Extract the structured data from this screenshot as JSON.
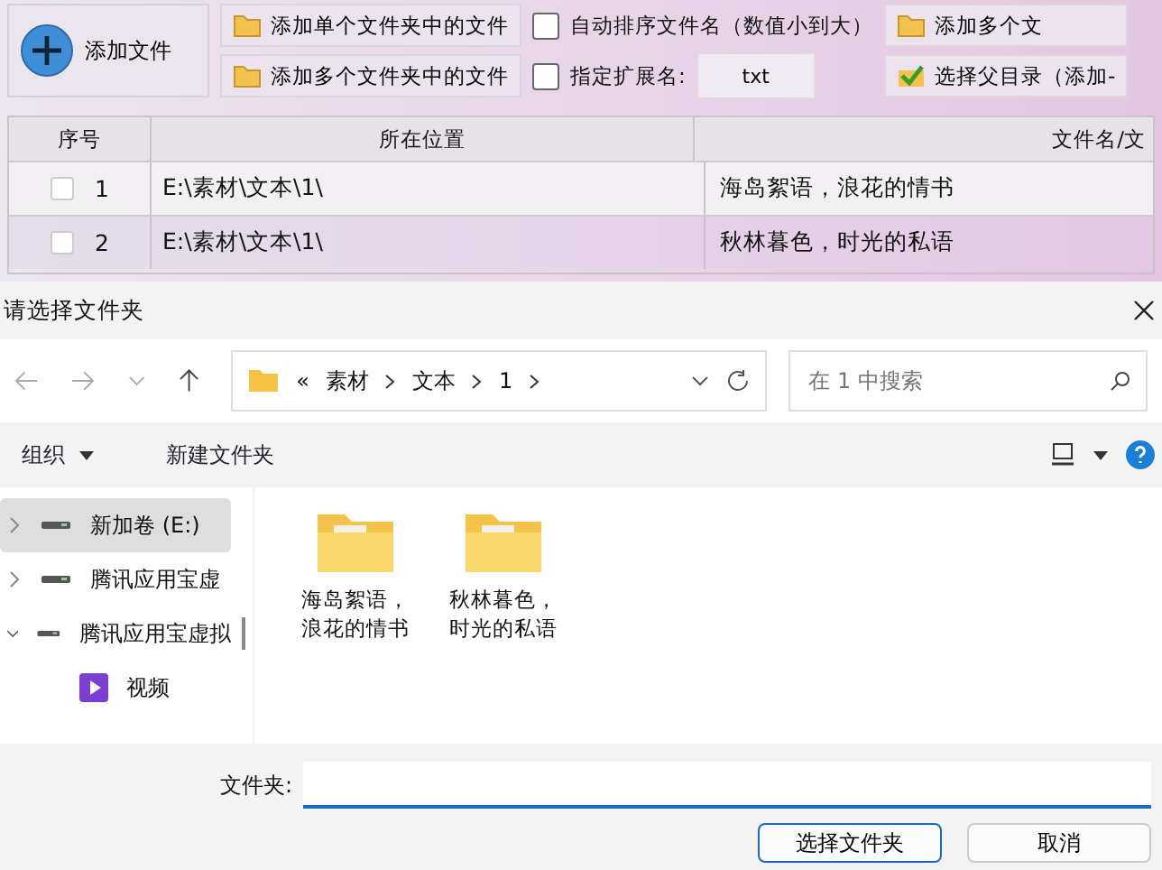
{
  "toolbar": {
    "add_file_button": "添加文件",
    "buttons": [
      {
        "label": "添加单个文件夹中的文件"
      },
      {
        "label": "添加多个文件夹中的文件"
      }
    ],
    "options": [
      {
        "kind": "checkbox",
        "label": "自动排序文件名（数值小到大）",
        "checked": false
      },
      {
        "kind": "extension",
        "label": "指定扩展名:",
        "checked": false,
        "value": "txt"
      }
    ],
    "right_buttons": [
      {
        "kind": "folder",
        "label": "添加多个文"
      },
      {
        "kind": "check",
        "label": "选择父目录（添加-"
      }
    ]
  },
  "table": {
    "columns": [
      "序号",
      "所在位置",
      "文件名/文"
    ],
    "rows": [
      {
        "index": "1",
        "location": "E:\\素材\\文本\\1\\",
        "name": "海岛絮语，浪花的情书",
        "checked": false,
        "selected": false
      },
      {
        "index": "2",
        "location": "E:\\素材\\文本\\1\\",
        "name": "秋林暮色，时光的私语",
        "checked": false,
        "selected": true
      }
    ]
  },
  "dialog": {
    "title": "请选择文件夹",
    "overflow_mark": "«",
    "breadcrumb": [
      "素材",
      "文本",
      "1"
    ],
    "search": {
      "placeholder": "在 1 中搜索"
    },
    "commands": [
      {
        "label": "组织",
        "dropdown": true
      },
      {
        "label": "新建文件夹",
        "dropdown": false
      }
    ],
    "tree": [
      {
        "label": "新加卷 (E:)",
        "kind": "drive",
        "expanded": false,
        "selected": true
      },
      {
        "label": "腾讯应用宝虚",
        "kind": "drive",
        "expanded": false,
        "selected": false
      },
      {
        "label": "腾讯应用宝虚拟",
        "kind": "drive",
        "expanded": true,
        "selected": false,
        "children": [
          {
            "label": "视频",
            "kind": "video",
            "expanded": false,
            "selected": false
          }
        ]
      }
    ],
    "folders": [
      {
        "lines": [
          "海岛絮语，",
          "浪花的情书"
        ]
      },
      {
        "lines": [
          "秋林暮色，",
          "时光的私语"
        ]
      }
    ],
    "filename": {
      "label": "文件夹:"
    },
    "buttons": [
      {
        "label": "选择文件夹",
        "primary": true
      },
      {
        "label": "取消",
        "primary": false
      }
    ]
  }
}
